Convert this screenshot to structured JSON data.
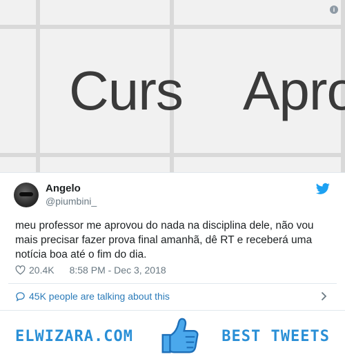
{
  "media": {
    "word_left": "Curs",
    "word_right": "Apro",
    "info_icon": "info-icon"
  },
  "tweet": {
    "display_name": "Angelo",
    "handle": "@piumbini_",
    "text": "meu professor me aprovou do nada na disciplina dele, não vou mais precisar fazer prova final amanhã, dê RT e receberá uma notícia boa até o fim do dia.",
    "likes": "20.4K",
    "timestamp": "8:58 PM - Dec 3, 2018",
    "conversation": "45K people are talking about this",
    "brand_color": "#1da1f2",
    "link_color": "#2b7bb9"
  },
  "footer": {
    "left_label": "ELWIZARA.COM",
    "right_label": "BEST TWEETS",
    "accent": "#2a8fd6"
  }
}
